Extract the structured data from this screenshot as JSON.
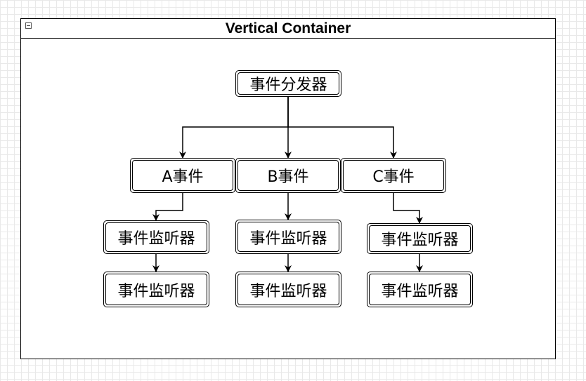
{
  "container": {
    "title": "Vertical Container"
  },
  "nodes": {
    "dispatcher": "事件分发器",
    "event_a": "A事件",
    "event_b": "B事件",
    "event_c": "C事件",
    "listener_a1": "事件监听器",
    "listener_a2": "事件监听器",
    "listener_b1": "事件监听器",
    "listener_b2": "事件监听器",
    "listener_c1": "事件监听器",
    "listener_c2": "事件监听器"
  },
  "icons": {
    "collapse": "collapse-icon"
  },
  "colors": {
    "stroke": "#000000",
    "grid": "#e9e9e9",
    "background": "#ffffff"
  }
}
